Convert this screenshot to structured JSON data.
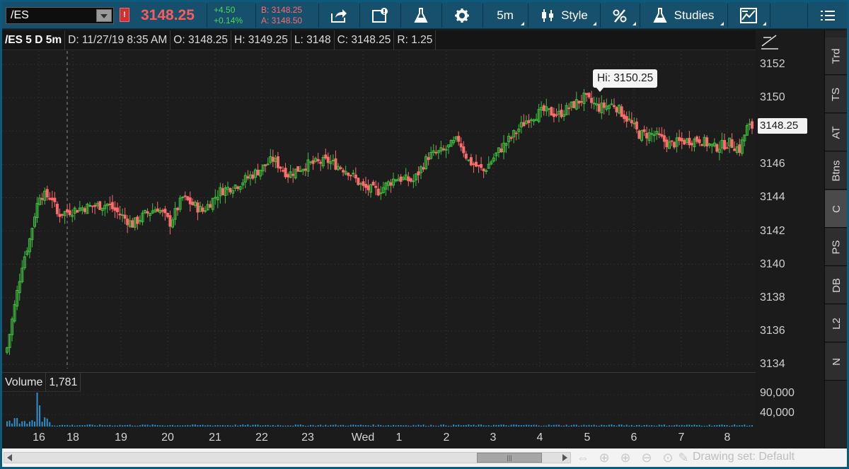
{
  "toolbar": {
    "symbol": "/ES",
    "alert_badge": "!",
    "last_price": "3148.25",
    "change_net": "+4.50",
    "change_pct": "+0.14%",
    "bid": "B: 3148.25",
    "ask": "A: 3148.50",
    "timeframe_label": "5m",
    "style_label": "Style",
    "studies_label": "Studies",
    "colors": {
      "toolbar_bg": "#16506d",
      "price_red": "#ff5a5a",
      "change_green": "#4cd94c"
    }
  },
  "header": {
    "symbol_period": "/ES 5 D 5m",
    "date": "D: 11/27/19 8:35 AM",
    "open": "O: 3148.25",
    "high": "H: 3149.25",
    "low": "L: 3148",
    "close": "C: 3148.25",
    "range": "R: 1.25"
  },
  "price_axis": {
    "labels": [
      "3152",
      "3150",
      "3148",
      "3146",
      "3144",
      "3142",
      "3140",
      "3138",
      "3136",
      "3134"
    ],
    "current_price": "3148.25"
  },
  "hi_marker": "Hi: 3150.25",
  "volume": {
    "label": "Volume",
    "value": "1,781",
    "axis_labels": [
      "90,000",
      "40,000"
    ]
  },
  "time_axis": {
    "labels": [
      "16",
      "18",
      "19",
      "20",
      "21",
      "22",
      "23",
      "Wed",
      "1",
      "2",
      "3",
      "4",
      "5",
      "6",
      "7",
      "8"
    ]
  },
  "side_tabs": [
    "Trd",
    "TS",
    "AT",
    "Btns",
    "C",
    "PS",
    "DB",
    "L2",
    "N"
  ],
  "bottom_bar": {
    "drawing_set": "Drawing set: Default"
  },
  "chart_data": {
    "type": "candlestick",
    "ylim": [
      3134,
      3152.5
    ],
    "ylabel": "",
    "title": "",
    "up_color": "#3fbf3f",
    "down_color": "#ff6b6b",
    "x_labels": [
      "16",
      "18",
      "19",
      "20",
      "21",
      "22",
      "23",
      "Wed",
      "1",
      "2",
      "3",
      "4",
      "5",
      "6",
      "7",
      "8"
    ],
    "close_path_keypoints": [
      [
        0,
        3135.0
      ],
      [
        3,
        3137.5
      ],
      [
        6,
        3140.0
      ],
      [
        9,
        3141.5
      ],
      [
        11,
        3143.0
      ],
      [
        13,
        3144.2
      ],
      [
        18,
        3144.0
      ],
      [
        20,
        3143.0
      ],
      [
        30,
        3143.4
      ],
      [
        40,
        3143.6
      ],
      [
        45,
        3143.0
      ],
      [
        50,
        3142.4
      ],
      [
        55,
        3143.0
      ],
      [
        60,
        3143.4
      ],
      [
        65,
        3142.5
      ],
      [
        70,
        3144.0
      ],
      [
        78,
        3143.2
      ],
      [
        85,
        3144.4
      ],
      [
        92,
        3144.8
      ],
      [
        100,
        3145.6
      ],
      [
        106,
        3146.3
      ],
      [
        112,
        3145.4
      ],
      [
        120,
        3146.0
      ],
      [
        128,
        3146.2
      ],
      [
        136,
        3145.6
      ],
      [
        142,
        3144.6
      ],
      [
        148,
        3144.4
      ],
      [
        155,
        3145.2
      ],
      [
        162,
        3145.0
      ],
      [
        168,
        3146.5
      ],
      [
        174,
        3146.8
      ],
      [
        180,
        3147.5
      ],
      [
        184,
        3146.2
      ],
      [
        190,
        3145.6
      ],
      [
        196,
        3146.8
      ],
      [
        202,
        3147.8
      ],
      [
        208,
        3148.8
      ],
      [
        214,
        3149.2
      ],
      [
        220,
        3149.0
      ],
      [
        226,
        3149.6
      ],
      [
        230,
        3150.0
      ],
      [
        236,
        3149.4
      ],
      [
        242,
        3149.6
      ],
      [
        248,
        3148.6
      ],
      [
        252,
        3147.8
      ],
      [
        258,
        3147.8
      ],
      [
        264,
        3147.2
      ],
      [
        270,
        3147.4
      ],
      [
        276,
        3147.5
      ],
      [
        282,
        3147.0
      ],
      [
        288,
        3147.3
      ],
      [
        292,
        3146.9
      ],
      [
        295,
        3148.2
      ],
      [
        297,
        3148.25
      ]
    ],
    "volume_spike_index": 12
  }
}
